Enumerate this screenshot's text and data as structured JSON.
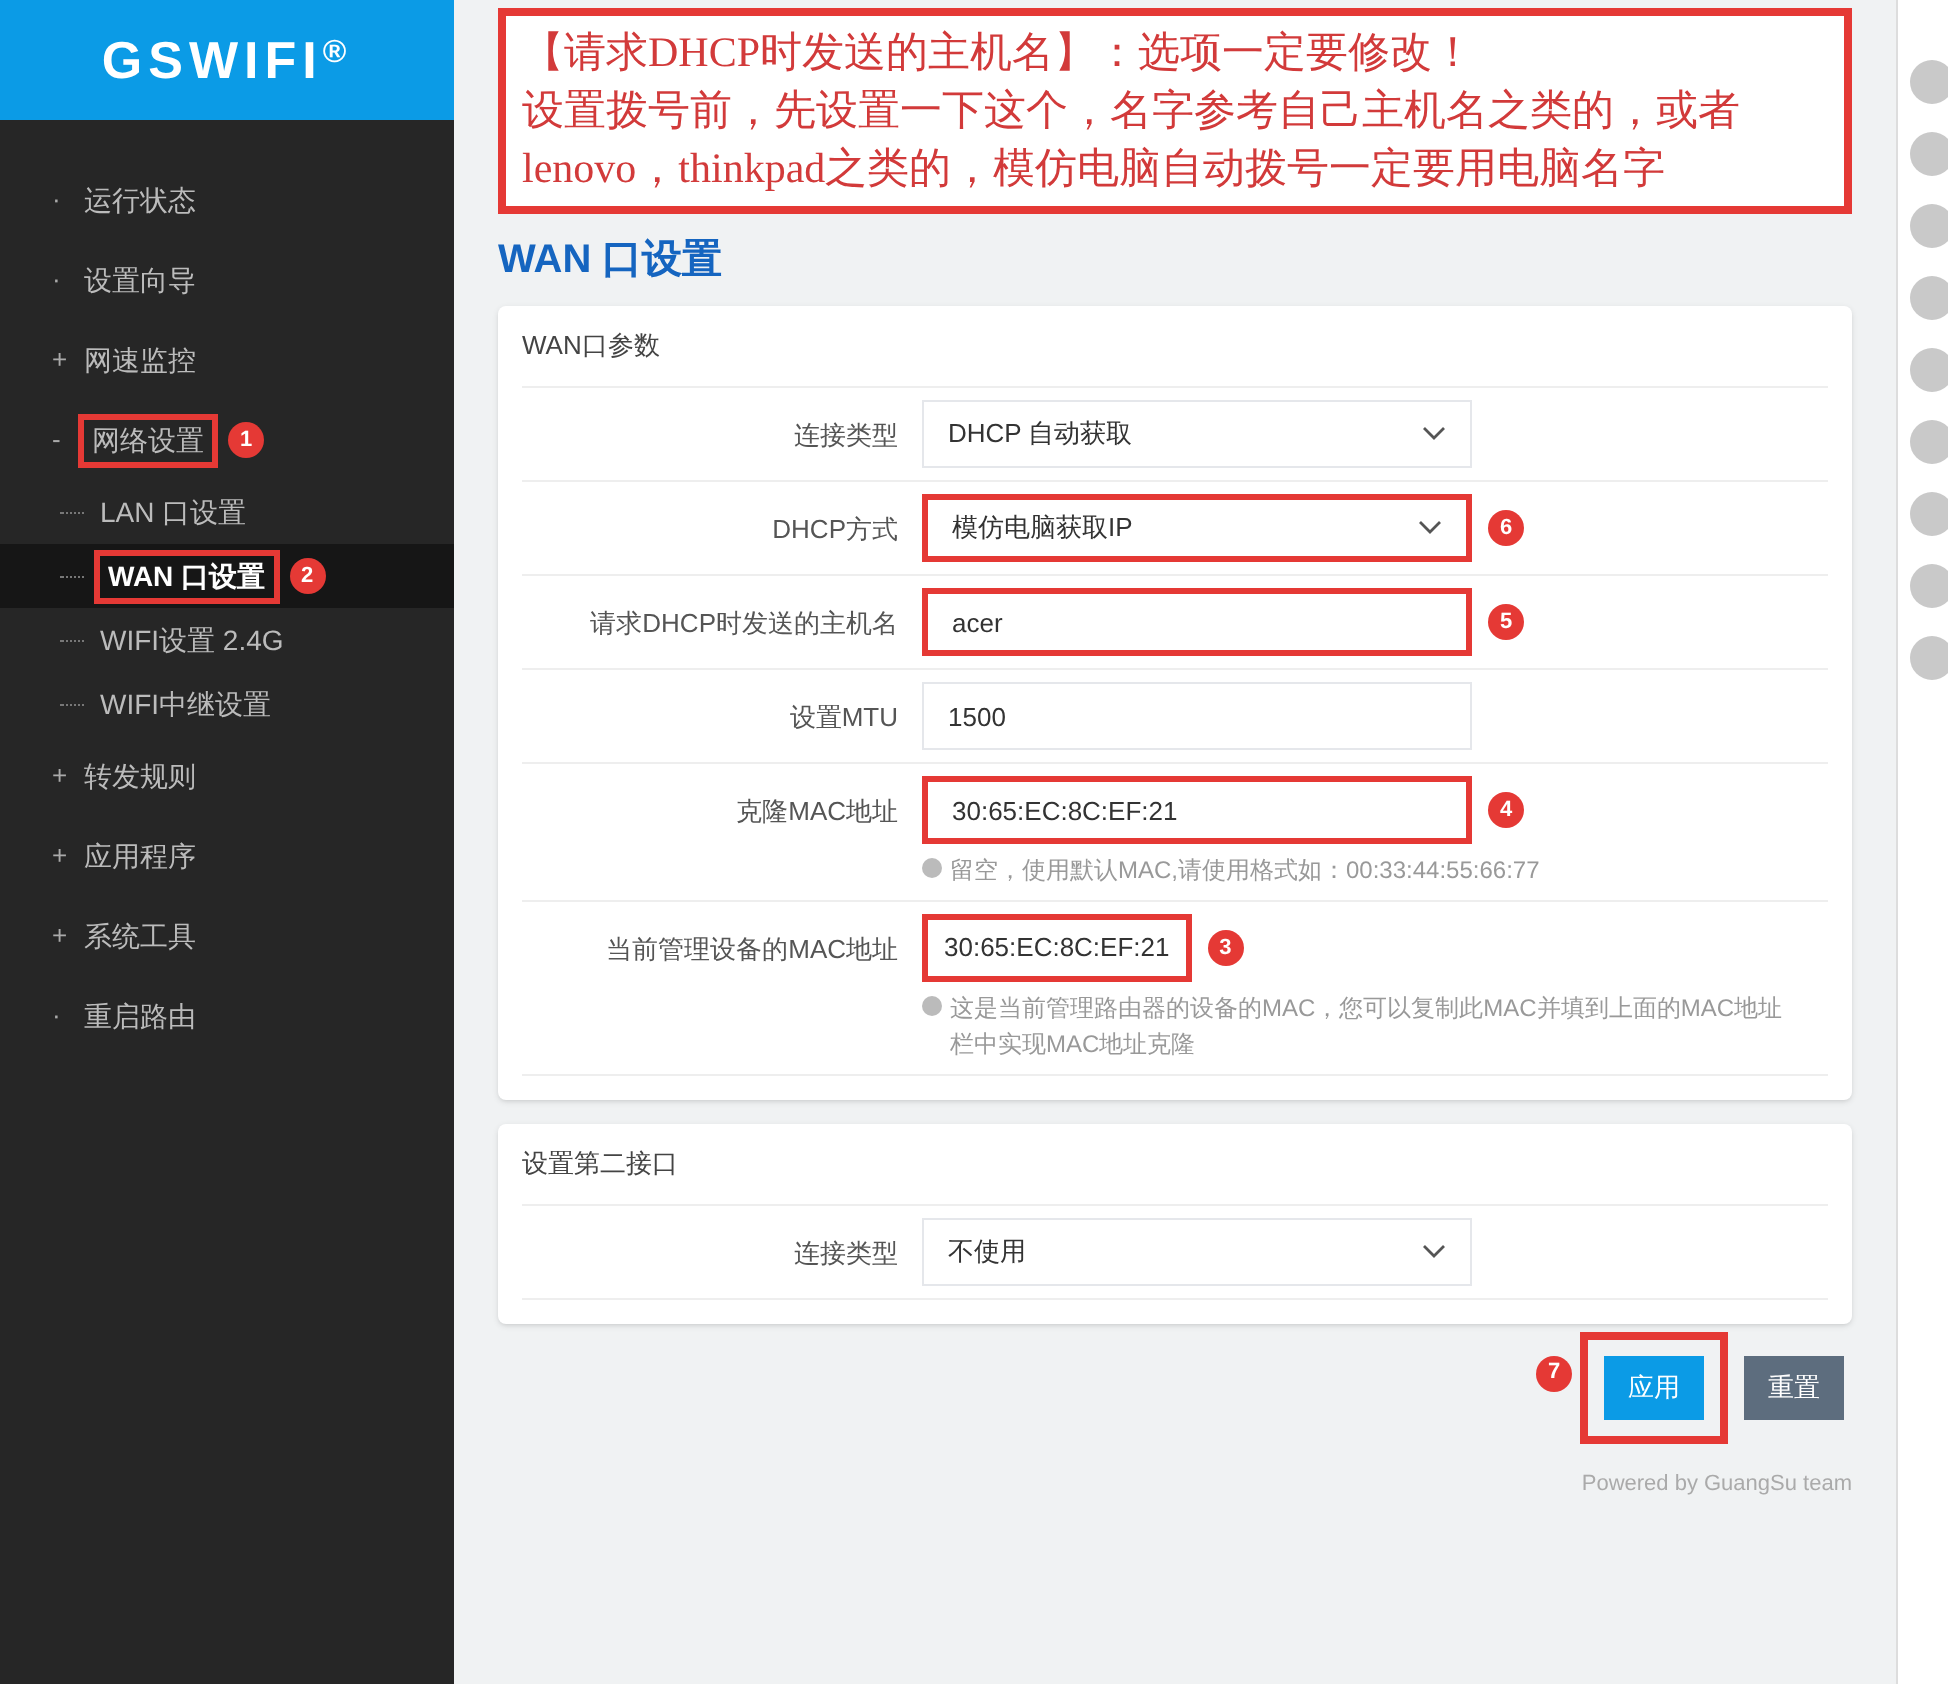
{
  "brand": {
    "name": "GSWIFI",
    "mark": "®"
  },
  "sidebar": {
    "items": [
      {
        "prefix": "·",
        "label": "运行状态",
        "selected": false
      },
      {
        "prefix": "·",
        "label": "设置向导",
        "selected": false
      },
      {
        "prefix": "+",
        "label": "网速监控",
        "selected": false
      },
      {
        "prefix": "-",
        "label": "网络设置",
        "selected": false,
        "badge": "1",
        "children": [
          {
            "label": "LAN 口设置",
            "selected": false
          },
          {
            "label": "WAN 口设置",
            "selected": true,
            "badge": "2"
          },
          {
            "label": "WIFI设置 2.4G",
            "selected": false
          },
          {
            "label": "WIFI中继设置",
            "selected": false
          }
        ]
      },
      {
        "prefix": "+",
        "label": "转发规则",
        "selected": false
      },
      {
        "prefix": "+",
        "label": "应用程序",
        "selected": false
      },
      {
        "prefix": "+",
        "label": "系统工具",
        "selected": false
      },
      {
        "prefix": "·",
        "label": "重启路由",
        "selected": false
      }
    ]
  },
  "annotation_note": {
    "heading": "【请求DHCP时发送的主机名】：选项一定要修改！",
    "body": "设置拨号前，先设置一下这个，名字参考自己主机名之类的，或者lenovo，thinkpad之类的，模仿电脑自动拨号一定要用电脑名字"
  },
  "page_title": "WAN 口设置",
  "wan_card": {
    "title": "WAN口参数",
    "rows": [
      {
        "kind": "select",
        "label": "连接类型",
        "value": "DHCP 自动获取"
      },
      {
        "kind": "select",
        "label": "DHCP方式",
        "value": "模仿电脑获取IP",
        "badge": "6"
      },
      {
        "kind": "input",
        "label": "请求DHCP时发送的主机名",
        "value": "acer",
        "badge": "5"
      },
      {
        "kind": "input",
        "label": "设置MTU",
        "value": "1500"
      },
      {
        "kind": "input",
        "label": "克隆MAC地址",
        "value": "30:65:EC:8C:EF:21",
        "badge": "4",
        "hint": "留空，使用默认MAC,请使用格式如：00:33:44:55:66:77"
      },
      {
        "kind": "text",
        "label": "当前管理设备的MAC地址",
        "value": "30:65:EC:8C:EF:21",
        "badge": "3",
        "hint": "这是当前管理路由器的设备的MAC，您可以复制此MAC并填到上面的MAC地址栏中实现MAC地址克隆"
      }
    ]
  },
  "second_card": {
    "title": "设置第二接口",
    "rows": [
      {
        "kind": "select",
        "label": "连接类型",
        "value": "不使用"
      }
    ]
  },
  "buttons": [
    {
      "kind": "primary",
      "label": "应用",
      "badge": "7"
    },
    {
      "kind": "secondary",
      "label": "重置"
    }
  ],
  "footer": "Powered by GuangSu team"
}
